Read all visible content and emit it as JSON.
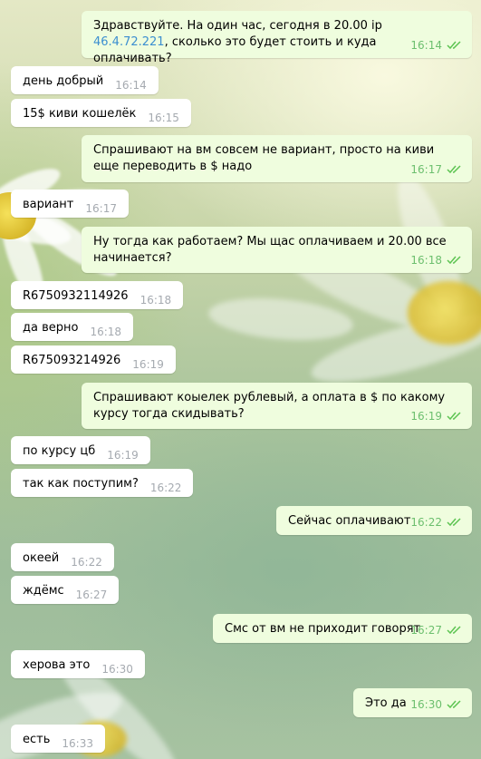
{
  "chat": {
    "messages": [
      {
        "dir": "out",
        "text_before": "Здравствуйте. На один час, сегодня в 20.00 ip ",
        "link": "46.4.72.221",
        "text_after": ", сколько это будет стоить и куда оплачивать?",
        "time": "16:14",
        "status": "read-double-check-icon"
      },
      {
        "dir": "in",
        "text": "день добрый",
        "time": "16:14"
      },
      {
        "dir": "in",
        "text": "15$ киви кошелёк",
        "time": "16:15"
      },
      {
        "dir": "out",
        "text": "Спрашивают на вм совсем не вариант, просто на киви еще переводить в $ надо",
        "time": "16:17",
        "status": "read-double-check-icon"
      },
      {
        "dir": "in",
        "text": "вариант",
        "time": "16:17"
      },
      {
        "dir": "out",
        "text": "Ну тогда как работаем? Мы щас оплачиваем и 20.00 все начинается?",
        "time": "16:18",
        "status": "read-double-check-icon"
      },
      {
        "dir": "in",
        "text": "R6750932114926",
        "time": "16:18"
      },
      {
        "dir": "in",
        "text": "да верно",
        "time": "16:18"
      },
      {
        "dir": "in",
        "text": "R675093214926",
        "time": "16:19"
      },
      {
        "dir": "out",
        "text": "Спрашивают коыелек рублевый, а оплата в $ по какому курсу тогда скидывать?",
        "time": "16:19",
        "status": "read-double-check-icon"
      },
      {
        "dir": "in",
        "text": "по курсу цб",
        "time": "16:19"
      },
      {
        "dir": "in",
        "text": "так как поступим?",
        "time": "16:22"
      },
      {
        "dir": "out",
        "text": "Сейчас оплачивают",
        "time": "16:22",
        "status": "read-double-check-icon"
      },
      {
        "dir": "in",
        "text": "океей",
        "time": "16:22"
      },
      {
        "dir": "in",
        "text": "ждёмс",
        "time": "16:27"
      },
      {
        "dir": "out",
        "text": "Смс от вм не приходит говорят",
        "time": "16:27",
        "status": "read-double-check-icon"
      },
      {
        "dir": "in",
        "text": "херова это",
        "time": "16:30"
      },
      {
        "dir": "out",
        "text": "Это да",
        "time": "16:30",
        "status": "read-double-check-icon"
      },
      {
        "dir": "in",
        "text": "есть",
        "time": "16:33"
      }
    ]
  },
  "colors": {
    "outgoing_bubble": "#effdde",
    "incoming_bubble": "#ffffff",
    "outgoing_time": "#6cbf6e",
    "incoming_time": "#a5aab0",
    "link": "#3c8fd0",
    "tick": "#5dc452"
  },
  "background": {
    "motif": "chamomile-flowers-wallpaper"
  }
}
